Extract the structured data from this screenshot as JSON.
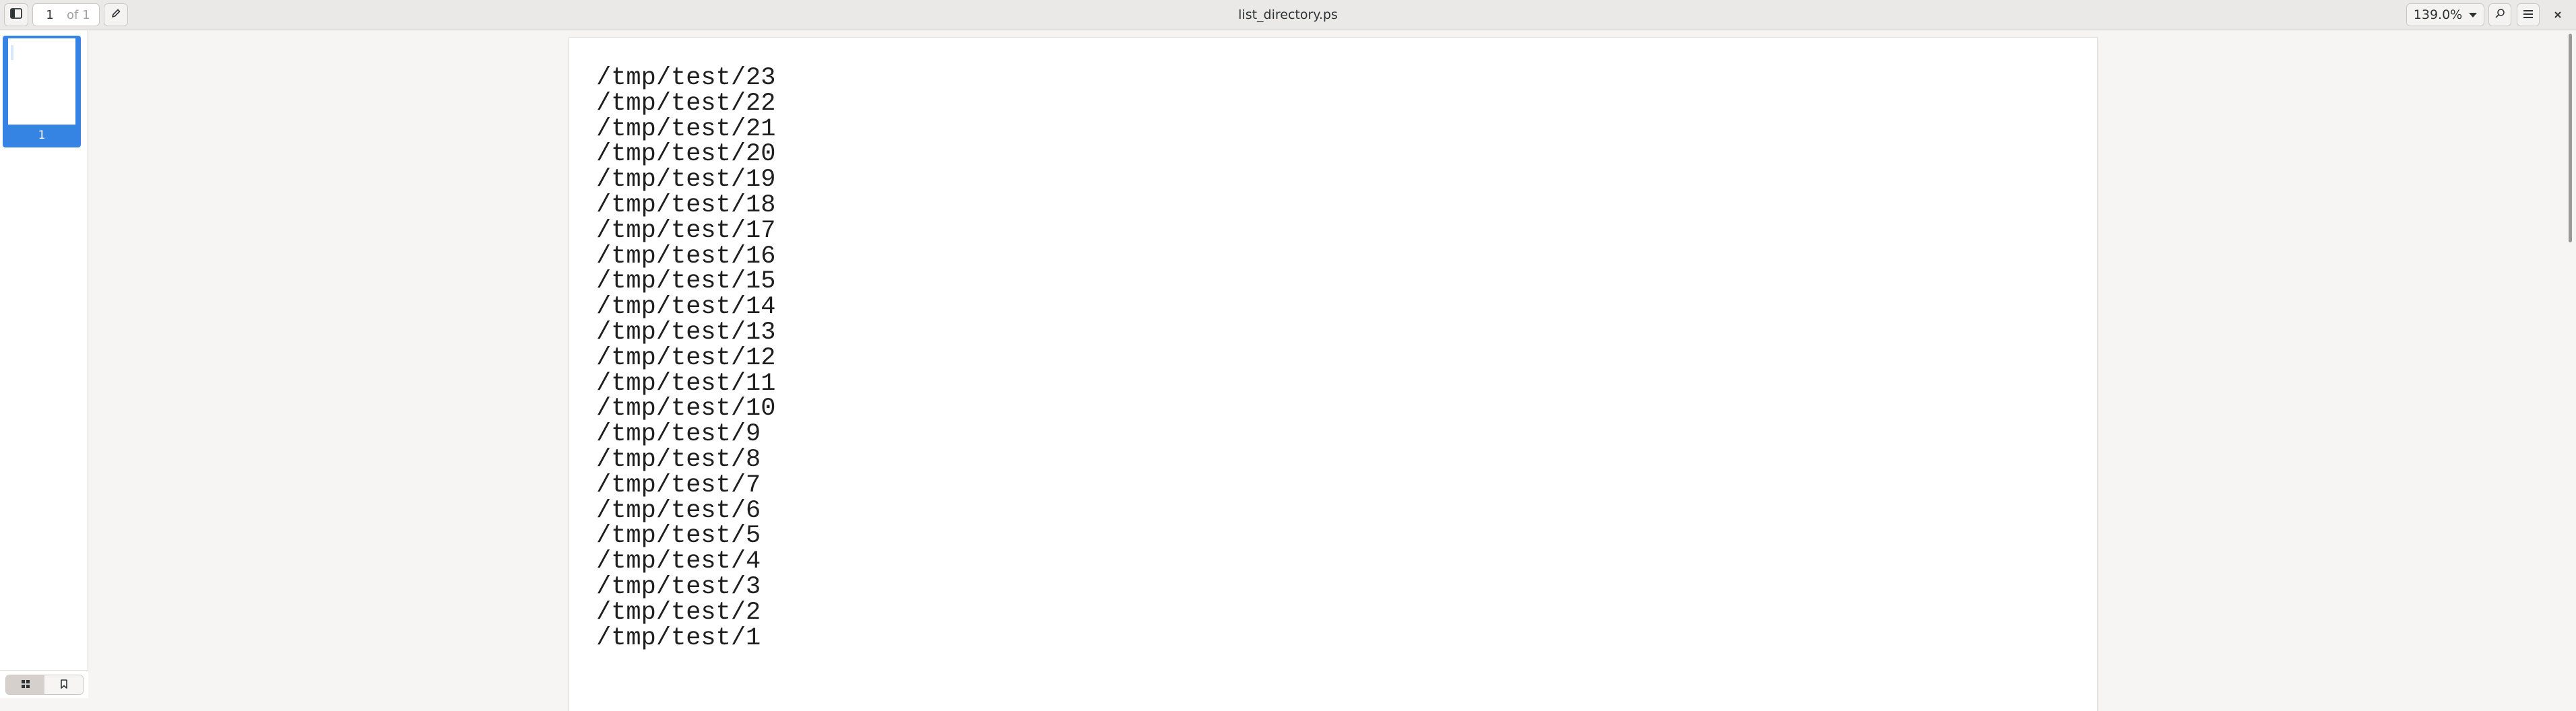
{
  "header": {
    "title": "list_directory.ps",
    "page_number": "1",
    "page_of": "of 1",
    "zoom": "139.0%"
  },
  "icons": {
    "sidebar_toggle": "sidebar-icon",
    "annotate": "pencil-icon",
    "search": "search-icon",
    "menu": "hamburger-menu-icon",
    "close": "close-icon",
    "thumbnails": "grid-icon",
    "bookmarks": "bookmark-icon"
  },
  "sidebar": {
    "thumbnail_label": "1"
  },
  "document": {
    "lines": [
      "/tmp/test/23",
      "/tmp/test/22",
      "/tmp/test/21",
      "/tmp/test/20",
      "/tmp/test/19",
      "/tmp/test/18",
      "/tmp/test/17",
      "/tmp/test/16",
      "/tmp/test/15",
      "/tmp/test/14",
      "/tmp/test/13",
      "/tmp/test/12",
      "/tmp/test/11",
      "/tmp/test/10",
      "/tmp/test/9",
      "/tmp/test/8",
      "/tmp/test/7",
      "/tmp/test/6",
      "/tmp/test/5",
      "/tmp/test/4",
      "/tmp/test/3",
      "/tmp/test/2",
      "/tmp/test/1"
    ]
  },
  "colors": {
    "accent": "#3584e4",
    "headerbar": "#ebe9e7",
    "background": "#f6f5f4"
  }
}
